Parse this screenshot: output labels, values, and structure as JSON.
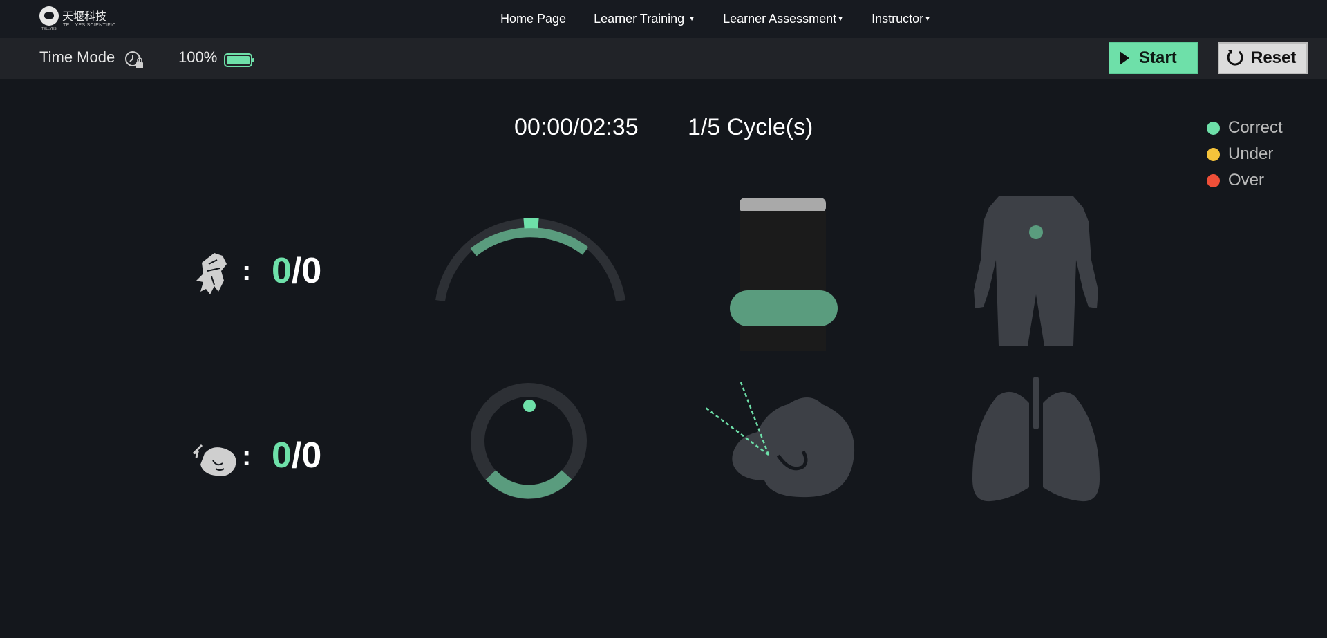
{
  "nav": {
    "logo_cn": "天堰科技",
    "logo_en": "TELLYES SCIENTIFIC",
    "logo_en_small": "TELLYES",
    "items": [
      {
        "label": "Home Page",
        "has_caret": false
      },
      {
        "label": "Learner Training",
        "has_caret": true
      },
      {
        "label": "Learner Assessment",
        "has_caret": true
      },
      {
        "label": "Instructor",
        "has_caret": true
      }
    ]
  },
  "toolbar": {
    "mode_label": "Time Mode",
    "battery_percent_label": "100%",
    "battery_level": 1.0,
    "start_label": "Start",
    "reset_label": "Reset"
  },
  "session": {
    "elapsed_total": "00:00/02:35",
    "cycles": "1/5 Cycle(s)"
  },
  "legend": [
    {
      "label": "Correct",
      "color": "#6ee0a9"
    },
    {
      "label": "Under",
      "color": "#f5c33b"
    },
    {
      "label": "Over",
      "color": "#ef4f38"
    }
  ],
  "compressions": {
    "correct": "0",
    "total": "/0"
  },
  "ventilations": {
    "correct": "0",
    "total": "/0"
  },
  "colors": {
    "accent": "#6ee0a9",
    "accent_dim": "#5a9c7e",
    "track": "#2d3035",
    "silhouette": "#3d4046",
    "background": "#14171c"
  }
}
